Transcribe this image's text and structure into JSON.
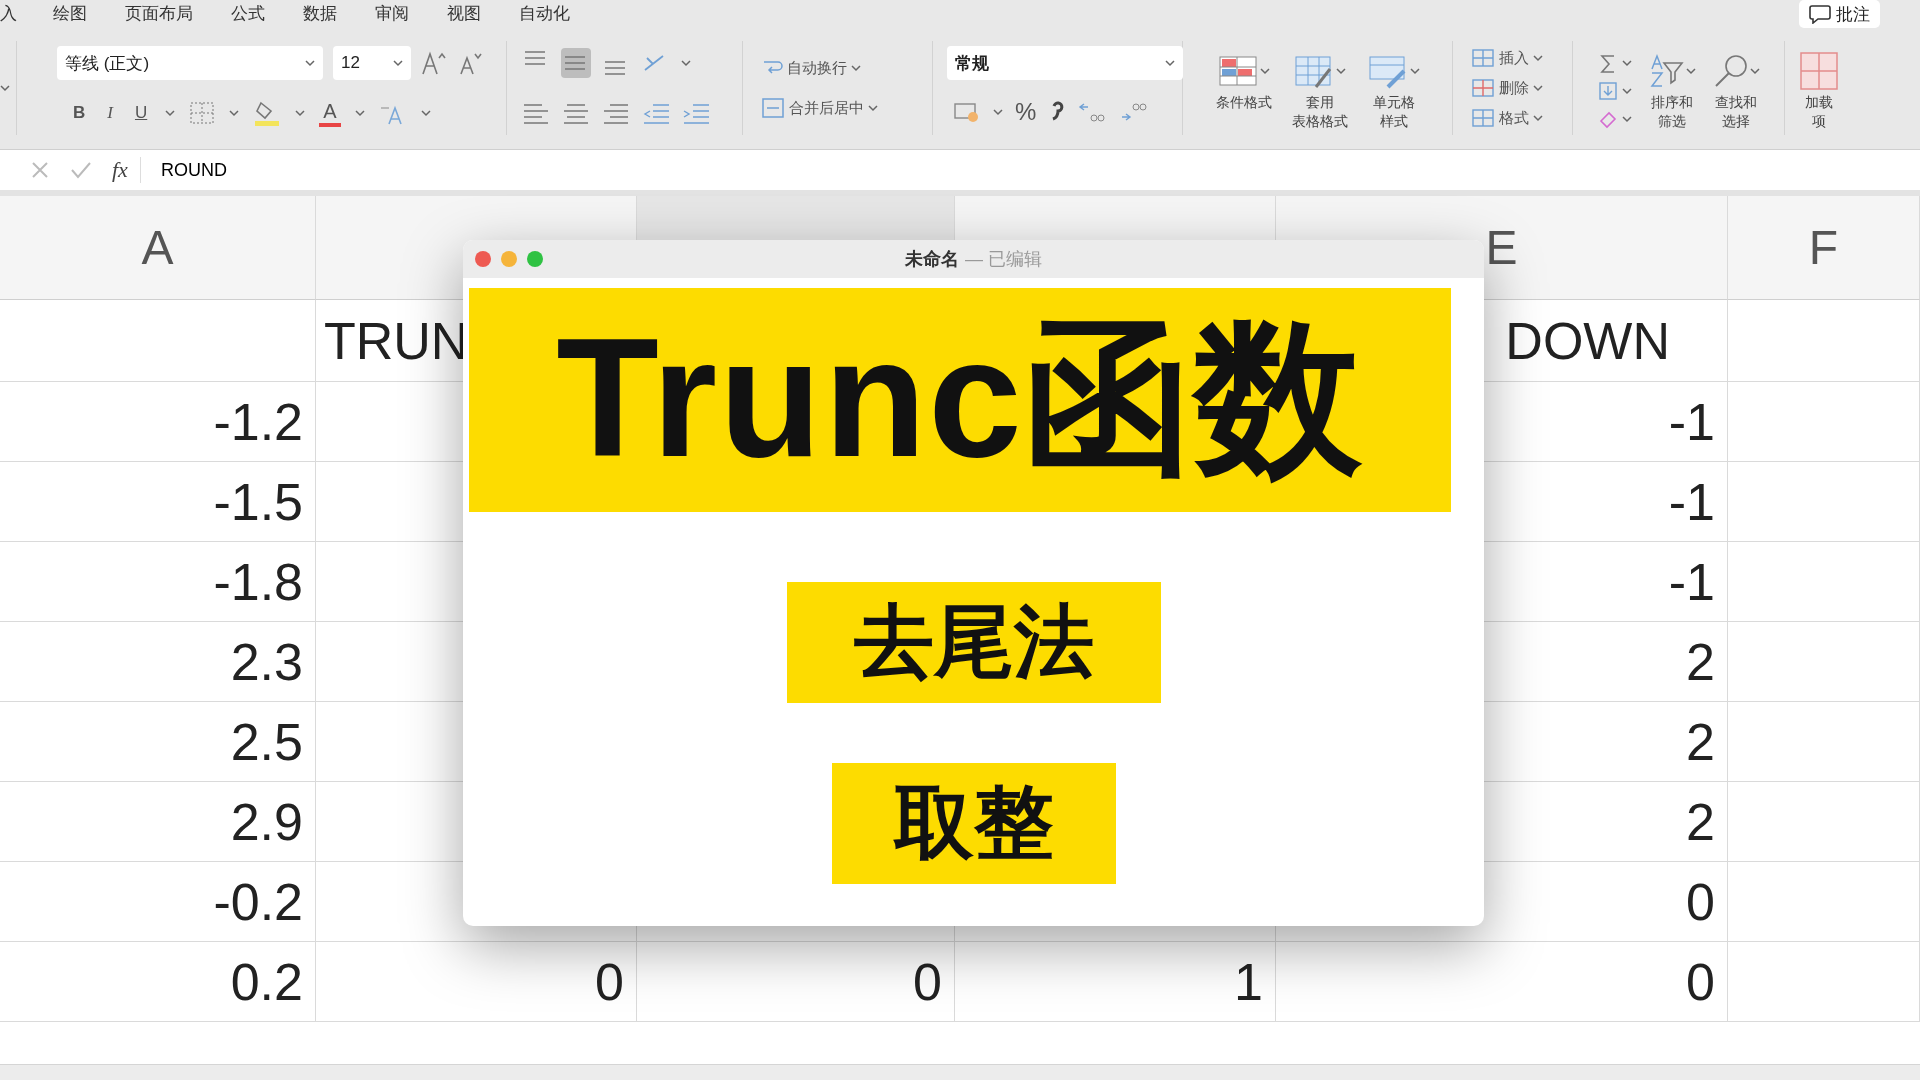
{
  "menu_tabs": [
    "入",
    "绘图",
    "页面布局",
    "公式",
    "数据",
    "审阅",
    "视图",
    "自动化"
  ],
  "comment_button": "批注",
  "ribbon": {
    "font_name": "等线 (正文)",
    "font_size": "12",
    "bold": "B",
    "italic": "I",
    "underline": "U",
    "font_color": "A",
    "vertical_align": [
      {
        "selected": false
      },
      {
        "selected": true
      },
      {
        "selected": false
      }
    ],
    "wrap_text": "自动换行",
    "merge_center": "合并后居中",
    "number_format": "常规",
    "percent": "%",
    "styles": [
      [
        "条件格式"
      ],
      [
        "套用",
        "表格格式"
      ],
      [
        "单元格",
        "样式"
      ]
    ],
    "cells": [
      "插入",
      "删除",
      "格式"
    ],
    "editing": [
      [
        "排序和",
        "筛选"
      ],
      [
        "查找和",
        "选择"
      ]
    ],
    "addins": [
      "加载",
      "项"
    ]
  },
  "formula_bar": {
    "fx": "fx",
    "value": "ROUND"
  },
  "sheet": {
    "columns": [
      {
        "letter": "A",
        "selected": false
      },
      {
        "selected": false
      },
      {
        "selected": true
      },
      {
        "selected": false
      },
      {
        "letter": "E",
        "selected": false
      },
      {
        "letter": "F",
        "selected": false
      }
    ],
    "rows": [
      [
        "",
        "TRUN",
        "",
        "",
        "DOWN",
        ""
      ],
      [
        "-1.2",
        "",
        "",
        "",
        "-1",
        ""
      ],
      [
        "-1.5",
        "",
        "",
        "",
        "-1",
        ""
      ],
      [
        "-1.8",
        "",
        "",
        "",
        "-1",
        ""
      ],
      [
        "2.3",
        "",
        "",
        "",
        "2",
        ""
      ],
      [
        "2.5",
        "",
        "",
        "",
        "2",
        ""
      ],
      [
        "2.9",
        "",
        "",
        "",
        "2",
        ""
      ],
      [
        "-0.2",
        "",
        "",
        "",
        "0",
        ""
      ],
      [
        "0.2",
        "0",
        "0",
        "1",
        "0",
        ""
      ]
    ]
  },
  "dialog": {
    "title": "未命名",
    "subtitle": "— 已编辑",
    "banner": "Trunc函数",
    "tags": [
      "去尾法",
      "取整"
    ]
  }
}
